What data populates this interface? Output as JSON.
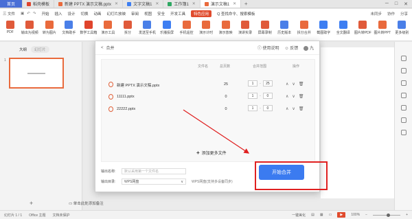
{
  "tabs": [
    {
      "label": "首页",
      "color": "#4a6fd6"
    },
    {
      "label": "稻壳模板",
      "color": "#e0442c"
    },
    {
      "label": "新建 PPTX 演示文稿.pptx",
      "color": "#e96a3c"
    },
    {
      "label": "文字文稿1",
      "color": "#3d7ef2"
    },
    {
      "label": "工作簿1",
      "color": "#2ea862"
    },
    {
      "label": "演示文稿1",
      "color": "#e96a3c"
    }
  ],
  "menu": {
    "file": "三 文件",
    "items": [
      "开始",
      "插入",
      "设计",
      "切换",
      "动画",
      "幻灯片放映",
      "审阅",
      "视图",
      "安全",
      "开发工具",
      "特色应用"
    ],
    "active_index": 10,
    "search": "Q 查找命令、搜索模板",
    "cloud": "未同步",
    "collab": "协作",
    "share": "分享"
  },
  "ribbon": [
    {
      "label": "PDF",
      "color": "#e05a3a"
    },
    {
      "label": "输出为视频",
      "color": "#e05a3a"
    },
    {
      "label": "转为图片",
      "color": "#e96a3c"
    },
    {
      "label": "文档助手",
      "color": "#4a7fe8"
    },
    {
      "label": "数学工具箱",
      "color": "#e0442c"
    },
    {
      "label": "演示工具",
      "color": "#e96a3c"
    },
    {
      "label": "拆分",
      "color": "#e05a3a"
    },
    {
      "label": "发送至手机",
      "color": "#4a7fe8"
    },
    {
      "label": "乐播投屏",
      "color": "#3d7ef2"
    },
    {
      "label": "手机遥控",
      "color": "#e96a3c"
    },
    {
      "label": "演示计时",
      "color": "#e96a3c"
    },
    {
      "label": "演示放映",
      "color": "#e96a3c"
    },
    {
      "label": "演讲实录",
      "color": "#e05a3a"
    },
    {
      "label": "屏幕录制",
      "color": "#e05a3a"
    },
    {
      "label": "历史版本",
      "color": "#4a7fe8"
    },
    {
      "label": "拆分合并",
      "color": "#e96a3c"
    },
    {
      "label": "截图取字",
      "color": "#3d7ef2"
    },
    {
      "label": "全文翻译",
      "color": "#3d7ef2"
    },
    {
      "label": "图片转PDF",
      "color": "#e05a3a"
    },
    {
      "label": "图片转PPT",
      "color": "#e96a3c"
    },
    {
      "label": "更多级别",
      "color": "#4a7fe8"
    }
  ],
  "left_panel": {
    "tab_outline": "大纲",
    "tab_slides": "幻灯片",
    "slide_number": "1",
    "add_icon": "+"
  },
  "notes_hint": "单击此处添加备注",
  "dialog": {
    "back": "<",
    "title": "合并",
    "help": "使用说明",
    "feedback": "反馈",
    "user": "九",
    "columns": {
      "name": "文件名",
      "pages": "总页数",
      "range": "合并范围",
      "ops": "操作"
    },
    "files": [
      {
        "name": "新建 PPTX 演示文稿.pptx",
        "pages": "25",
        "from": "1",
        "to": "25"
      },
      {
        "name": "11111.pptx",
        "pages": "0",
        "from": "1",
        "to": "0"
      },
      {
        "name": "22222.pptx",
        "pages": "0",
        "from": "1",
        "to": "0"
      }
    ],
    "range_sep": "-",
    "add_more": "添加更多文件",
    "output_name_label": "输出名称:",
    "output_name_placeholder": "默认采用第一个文件名",
    "output_dir_label": "输出目录:",
    "output_dir_value": "WPS网盘",
    "output_dir_hint": "WPS网盘(支持多设备同步)",
    "start_button": "开始合并"
  },
  "status": {
    "slide": "幻灯片 1 / 1",
    "theme": "Office 主题",
    "doc_state": "文档未保护",
    "beautify": "一键美化",
    "zoom": "100%"
  },
  "accent": {
    "active": "#e04b2d",
    "primary": "#3b7bf0",
    "highlight": "#e02020"
  }
}
